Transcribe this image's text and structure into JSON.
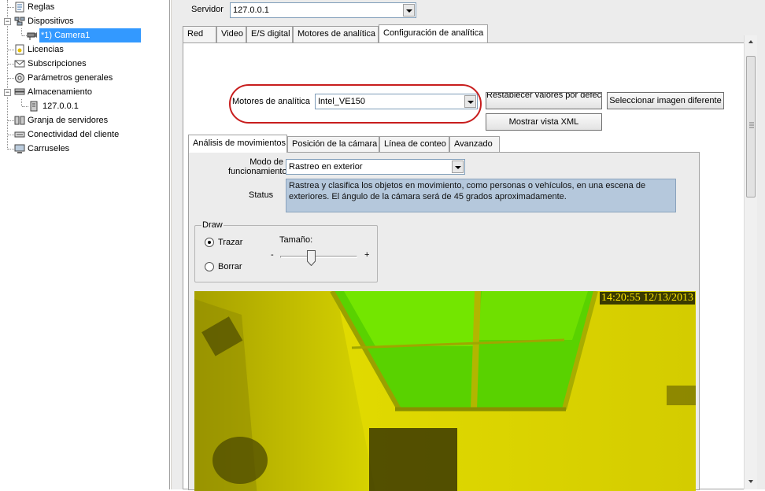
{
  "tree": {
    "items": [
      {
        "label": "Reglas",
        "icon": "rules-icon"
      },
      {
        "label": "Dispositivos",
        "icon": "devices-icon",
        "expander": "−"
      },
      {
        "label": "*1) Camera1",
        "icon": "camera-icon"
      },
      {
        "label": "Licencias",
        "icon": "license-icon"
      },
      {
        "label": "Subscripciones",
        "icon": "subscriptions-icon"
      },
      {
        "label": "Parámetros generales",
        "icon": "settings-icon"
      },
      {
        "label": "Almacenamiento",
        "icon": "storage-icon",
        "expander": "−"
      },
      {
        "label": "127.0.0.1",
        "icon": "server-icon"
      },
      {
        "label": "Granja de servidores",
        "icon": "server-farm-icon"
      },
      {
        "label": "Conectividad del cliente",
        "icon": "connectivity-icon"
      },
      {
        "label": "Carruseles",
        "icon": "carousel-icon"
      }
    ]
  },
  "server": {
    "label": "Servidor",
    "value": "127.0.0.1"
  },
  "tabs": [
    {
      "label": "Red"
    },
    {
      "label": "Video"
    },
    {
      "label": "E/S digital"
    },
    {
      "label": "Motores de analítica"
    },
    {
      "label": "Configuración de analítica",
      "active": true
    }
  ],
  "engines": {
    "label": "Motores de analítica",
    "value": "Intel_VE150"
  },
  "buttons": {
    "restore": "Restablecer valores por defecto",
    "select_image": "Seleccionar imagen diferente",
    "xml": "Mostrar vista XML"
  },
  "subtabs": [
    {
      "label": "Análisis de movimientos",
      "active": true
    },
    {
      "label": "Posición de la cámara"
    },
    {
      "label": "Línea de conteo"
    },
    {
      "label": "Avanzado"
    }
  ],
  "mode": {
    "label": "Modo de funcionamiento",
    "value": "Rastreo en exterior"
  },
  "status": {
    "label": "Status",
    "text": "Rastrea y clasifica los objetos en movimiento, como personas o vehículos, en una escena de exteriores. El ángulo de la cámara será de 45 grados aproximadamente."
  },
  "draw": {
    "title": "Draw",
    "trazar": "Trazar",
    "borrar": "Borrar",
    "selected": "Trazar",
    "size_label": "Tamaño:",
    "minus": "-",
    "plus": "+",
    "size_level": 0.4
  },
  "camera": {
    "timestamp": "14:20:55 12/13/2013"
  },
  "colors": {
    "highlight": "#c81e1e",
    "selection": "#3399ff",
    "status_bg": "#b5c8dc"
  }
}
